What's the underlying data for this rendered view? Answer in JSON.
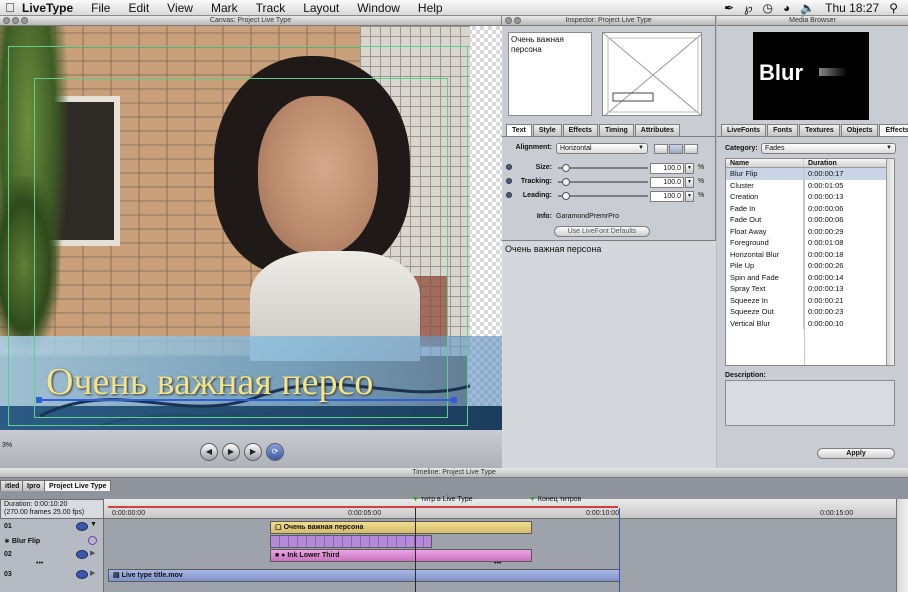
{
  "menubar": {
    "app": "LiveType",
    "items": [
      "File",
      "Edit",
      "View",
      "Mark",
      "Track",
      "Layout",
      "Window",
      "Help"
    ],
    "clock": "Thu 18:27"
  },
  "canvas": {
    "title": "Canvas: Project Live Type",
    "overlay_text": "Очень важная персо",
    "zoom": "3%"
  },
  "inspector": {
    "title": "Inspector: Project Live Type",
    "preview_text": "Очень важная персона",
    "tabs": [
      "Text",
      "Style",
      "Effects",
      "Timing",
      "Attributes"
    ],
    "alignment_label": "Alignment:",
    "alignment_value": "Horizontal",
    "size_label": "Size:",
    "size_value": "100.0",
    "tracking_label": "Tracking:",
    "tracking_value": "100.0",
    "leading_label": "Leading:",
    "leading_value": "100.0",
    "pct": "%",
    "info_label": "Info:",
    "info_value": "GaramondPremrPro",
    "defaults_button": "Use LiveFont Defaults",
    "text_entry": "Очень важная персона"
  },
  "media": {
    "title": "Media Browser",
    "preview_text": "Blur",
    "tabs": [
      "LiveFonts",
      "Fonts",
      "Textures",
      "Objects",
      "Effects"
    ],
    "category_label": "Category:",
    "category_value": "Fades",
    "col_name": "Name",
    "col_duration": "Duration",
    "rows": [
      {
        "name": "Blur Flip",
        "duration": "0:00:00:17"
      },
      {
        "name": "Cluster",
        "duration": "0:00:01:05"
      },
      {
        "name": "Creation",
        "duration": "0:00:00:13"
      },
      {
        "name": "Fade In",
        "duration": "0:00:00:06"
      },
      {
        "name": "Fade Out",
        "duration": "0:00:00:06"
      },
      {
        "name": "Float Away",
        "duration": "0:00:00:29"
      },
      {
        "name": "Foreground",
        "duration": "0:00:01:08"
      },
      {
        "name": "Horizontal Blur",
        "duration": "0:00:00:18"
      },
      {
        "name": "Pile Up",
        "duration": "0:00:00:26"
      },
      {
        "name": "Spin and Fade",
        "duration": "0:00:00:14"
      },
      {
        "name": "Spray Text",
        "duration": "0:00:00:13"
      },
      {
        "name": "Squeeze In",
        "duration": "0:00:00:21"
      },
      {
        "name": "Squeeze Out",
        "duration": "0:00:00:23"
      },
      {
        "name": "Vertical Blur",
        "duration": "0:00:00:10"
      }
    ],
    "description_label": "Description:",
    "apply_button": "Apply"
  },
  "timeline": {
    "title": "Timeline: Project Live Type",
    "tabs": [
      "itled",
      "Ipro",
      "Project Live Type"
    ],
    "duration_line1": "Duration: 0:00:10:20",
    "duration_line2": "(270.00 frames 25.00 fps)",
    "marker1": "титр в Live Type",
    "marker2": "Конец титров",
    "ticks": [
      "0:00:00:00",
      "0:00:05:00",
      "0:00:10:00",
      "0:00:15:00"
    ],
    "tracks": {
      "t1": "01",
      "t1_effect": "Blur Flip",
      "t2": "02",
      "t3": "03",
      "dots": "•••"
    },
    "clips": {
      "c1": "Очень важная персона",
      "c2": "Ink Lower Third",
      "c3": "Live type title.mov"
    }
  }
}
